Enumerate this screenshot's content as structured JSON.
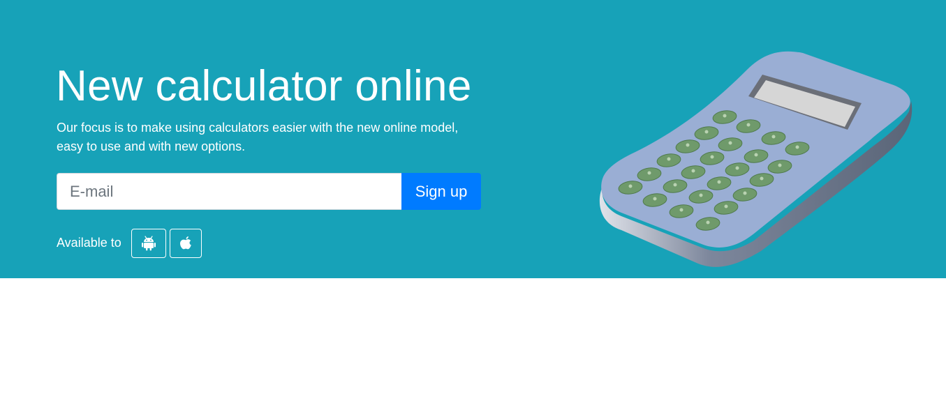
{
  "hero": {
    "title": "New calculator online",
    "lead": "Our focus is to make using calculators easier with the new online model, easy to use and with new options.",
    "background_color": "#17a2b8"
  },
  "signup_form": {
    "email_placeholder": "E-mail",
    "email_value": "",
    "submit_label": "Sign up",
    "button_color": "#007bff"
  },
  "availability": {
    "label": "Available to",
    "platforms": [
      {
        "name": "Android",
        "icon": "android-icon"
      },
      {
        "name": "Apple",
        "icon": "apple-icon"
      }
    ]
  },
  "illustration": {
    "icon": "calculator-illustration"
  }
}
